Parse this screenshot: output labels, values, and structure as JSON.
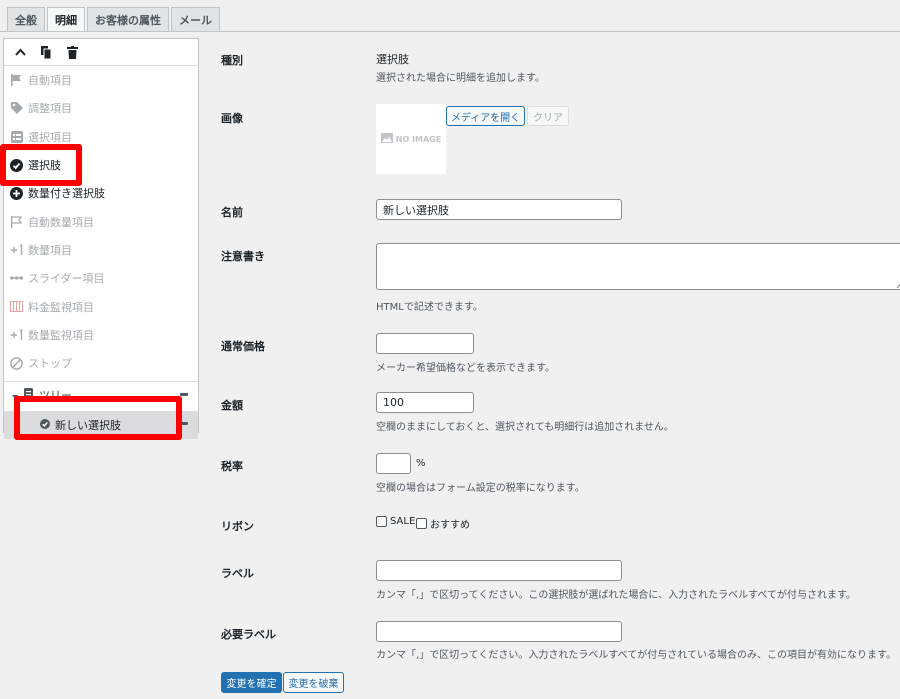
{
  "tabs": [
    "全般",
    "明細",
    "お客様の属性",
    "メール"
  ],
  "panel": {
    "items": [
      {
        "label": "自動項目",
        "icon": "flag-icon"
      },
      {
        "label": "調整項目",
        "icon": "tag-icon"
      },
      {
        "label": "選択項目",
        "icon": "list-icon"
      },
      {
        "label": "選択肢",
        "icon": "check-circle-icon"
      },
      {
        "label": "数量付き選択肢",
        "icon": "plus-circle-icon"
      },
      {
        "label": "自動数量項目",
        "icon": "flag-outline-icon"
      },
      {
        "label": "数量項目",
        "icon": "plus-one-icon"
      },
      {
        "label": "スライダー項目",
        "icon": "slider-icon"
      },
      {
        "label": "料金監視項目",
        "icon": "grid-icon"
      },
      {
        "label": "数量監視項目",
        "icon": "plus-one-icon"
      },
      {
        "label": "ストップ",
        "icon": "stop-icon"
      }
    ],
    "tree": {
      "label": "ツリー",
      "child": "新しい選択肢"
    }
  },
  "form": {
    "type_label": "種別",
    "type_value": "選択肢",
    "type_hint": "選択された場合に明細を追加します。",
    "image_label": "画像",
    "no_image": "NO IMAGE",
    "media_button": "メディアを開く",
    "clear_button": "クリア",
    "name_label": "名前",
    "name_value": "新しい選択肢",
    "note_label": "注意書き",
    "note_hint": "HTMLで記述できます。",
    "list_price_label": "通常価格",
    "list_price_hint": "メーカー希望価格などを表示できます。",
    "amount_label": "金額",
    "amount_value": "100",
    "amount_hint": "空欄のままにしておくと、選択されても明細行は追加されません。",
    "tax_label": "税率",
    "tax_unit": "%",
    "tax_hint": "空欄の場合はフォーム設定の税率になります。",
    "ribbon_label": "リボン",
    "ribbon_sale": "SALE",
    "ribbon_recommend": "おすすめ",
    "labels_label": "ラベル",
    "labels_hint": "カンマ「,」で区切ってください。この選択肢が選ばれた場合に、入力されたラベルすべてが付与されます。",
    "required_label": "必要ラベル",
    "required_hint": "カンマ「,」で区切ってください。入力されたラベルすべてが付与されている場合のみ、この項目が有効になります。",
    "apply_button": "変更を確定",
    "discard_button": "変更を破棄"
  },
  "colors": {
    "accent": "#2271b1",
    "highlight": "#ff0000"
  }
}
